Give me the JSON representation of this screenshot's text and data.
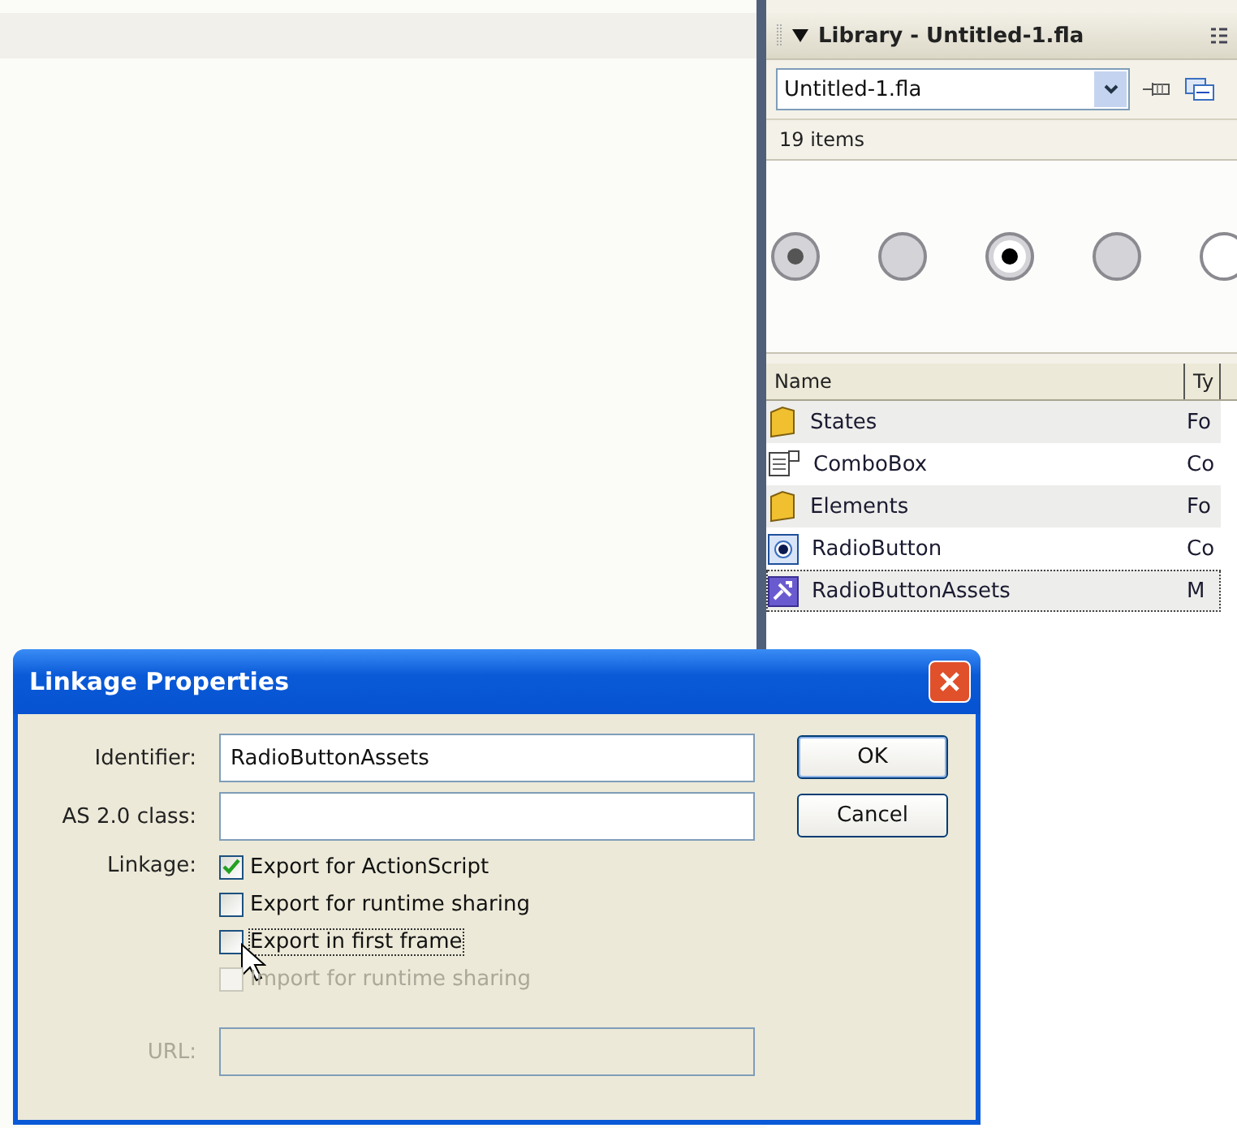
{
  "library": {
    "title": "Library - Untitled-1.fla",
    "document": "Untitled-1.fla",
    "item_count": "19 items",
    "columns": [
      "Name",
      "Ty"
    ],
    "rows": [
      {
        "name": "States",
        "type": "Fo",
        "kind": "folder",
        "focused": false
      },
      {
        "name": "ComboBox",
        "type": "Co",
        "kind": "combobox",
        "focused": false
      },
      {
        "name": "Elements",
        "type": "Fo",
        "kind": "folder",
        "focused": false
      },
      {
        "name": "RadioButton",
        "type": "Co",
        "kind": "radio",
        "focused": false
      },
      {
        "name": "RadioButtonAssets",
        "type": "M",
        "kind": "movieclip",
        "focused": true
      }
    ]
  },
  "dialog": {
    "title": "Linkage Properties",
    "fields": [
      {
        "label": "Identifier:",
        "value": "RadioButtonAssets",
        "disabled": false
      },
      {
        "label": "AS 2.0 class:",
        "disabled": false
      }
    ],
    "linkage_label": "Linkage:",
    "options": [
      {
        "label": "Export for ActionScript",
        "checked": true,
        "disabled": false,
        "focused": false
      },
      {
        "label": "Export for runtime sharing",
        "checked": false,
        "disabled": false,
        "focused": false
      },
      {
        "label": "Export in first frame",
        "checked": false,
        "disabled": false,
        "focused": true
      },
      {
        "label": "Import for runtime sharing",
        "checked": false,
        "disabled": true,
        "focused": false
      }
    ],
    "url": {
      "label": "URL:",
      "disabled": true
    },
    "buttons": [
      "OK",
      "Cancel"
    ]
  }
}
